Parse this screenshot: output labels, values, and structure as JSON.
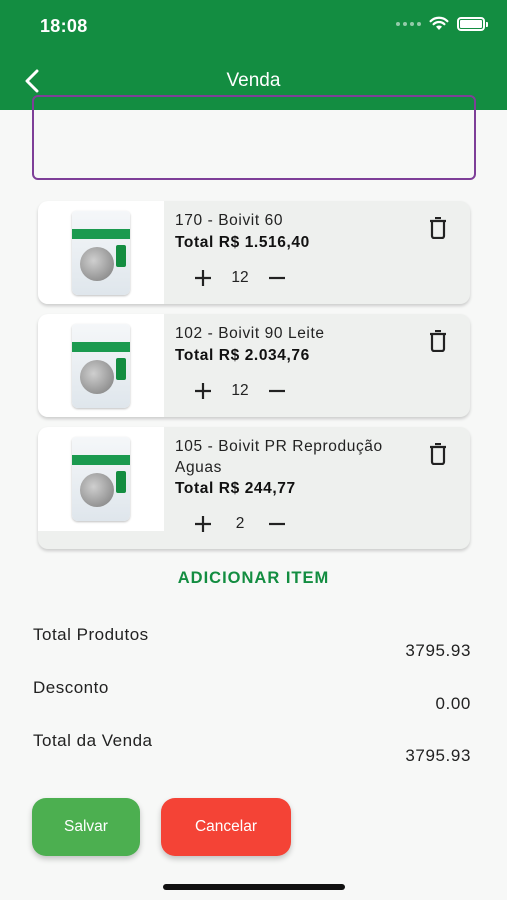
{
  "status_bar": {
    "time": "18:08",
    "icons": [
      "signal-dots-icon",
      "wifi-icon",
      "battery-icon"
    ]
  },
  "header": {
    "title": "Venda",
    "back_icon": "chevron-left-icon"
  },
  "colors": {
    "primary": "#138d41",
    "textarea_border": "#7e3f98",
    "save": "#4caf50",
    "cancel": "#f44336",
    "card_bg": "#eef0ee"
  },
  "items": [
    {
      "name": "170 - Boivit 60",
      "total": "Total R$ 1.516,40",
      "quantity": "12"
    },
    {
      "name": "102 - Boivit 90 Leite",
      "total": "Total R$ 2.034,76",
      "quantity": "12"
    },
    {
      "name": "105 - Boivit PR Reprodução Aguas",
      "total": "Total R$ 244,77",
      "quantity": "2"
    }
  ],
  "add_item_label": "ADICIONAR ITEM",
  "summary": {
    "total_produtos_label": "Total Produtos",
    "total_produtos_value": "3795.93",
    "desconto_label": "Desconto",
    "desconto_value": "0.00",
    "total_venda_label": "Total da Venda",
    "total_venda_value": "3795.93"
  },
  "actions": {
    "save_label": "Salvar",
    "cancel_label": "Cancelar"
  }
}
